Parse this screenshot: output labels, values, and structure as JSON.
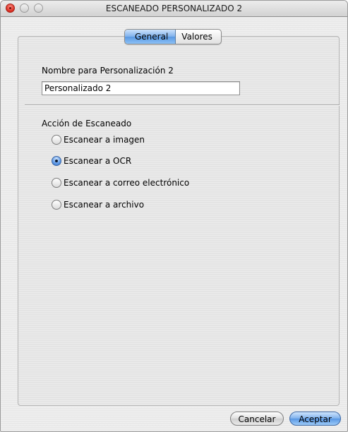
{
  "window": {
    "title": "ESCANEADO PERSONALIZADO 2"
  },
  "tabs": [
    {
      "label": "General",
      "active": true
    },
    {
      "label": "Valores",
      "active": false
    }
  ],
  "name_section": {
    "label": "Nombre para Personalización 2",
    "value": "Personalizado 2"
  },
  "scan_action": {
    "label": "Acción de Escaneado",
    "options": [
      {
        "label": "Escanear a imagen",
        "selected": false
      },
      {
        "label": "Escanear a OCR",
        "selected": true
      },
      {
        "label": "Escanear a correo electrónico",
        "selected": false
      },
      {
        "label": "Escanear a archivo",
        "selected": false
      }
    ]
  },
  "buttons": {
    "cancel": "Cancelar",
    "ok": "Aceptar"
  },
  "colors": {
    "accent": "#5a98e2",
    "close_button": "#d8281d"
  }
}
